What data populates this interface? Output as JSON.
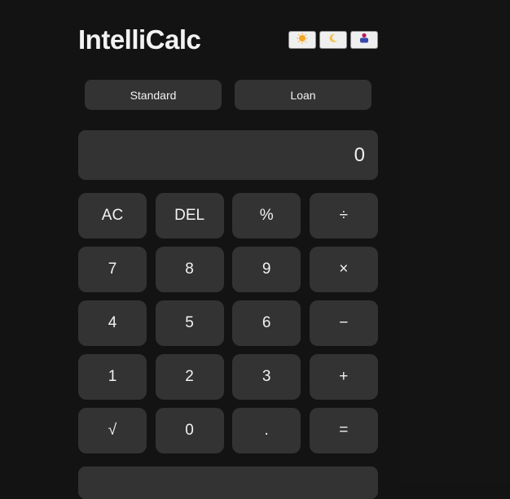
{
  "app": {
    "title": "IntelliCalc"
  },
  "themes": [
    {
      "name": "sun-icon"
    },
    {
      "name": "moon-icon"
    },
    {
      "name": "contrast-icon"
    }
  ],
  "tabs": [
    {
      "label": "Standard"
    },
    {
      "label": "Loan"
    }
  ],
  "display": {
    "value": "0"
  },
  "keys": [
    {
      "label": "AC",
      "name": "clear-all-button"
    },
    {
      "label": "DEL",
      "name": "delete-button"
    },
    {
      "label": "%",
      "name": "percent-button"
    },
    {
      "label": "÷",
      "name": "divide-button"
    },
    {
      "label": "7",
      "name": "digit-7-button"
    },
    {
      "label": "8",
      "name": "digit-8-button"
    },
    {
      "label": "9",
      "name": "digit-9-button"
    },
    {
      "label": "×",
      "name": "multiply-button"
    },
    {
      "label": "4",
      "name": "digit-4-button"
    },
    {
      "label": "5",
      "name": "digit-5-button"
    },
    {
      "label": "6",
      "name": "digit-6-button"
    },
    {
      "label": "−",
      "name": "subtract-button"
    },
    {
      "label": "1",
      "name": "digit-1-button"
    },
    {
      "label": "2",
      "name": "digit-2-button"
    },
    {
      "label": "3",
      "name": "digit-3-button"
    },
    {
      "label": "+",
      "name": "add-button"
    },
    {
      "label": "√",
      "name": "sqrt-button"
    },
    {
      "label": "0",
      "name": "digit-0-button"
    },
    {
      "label": ".",
      "name": "decimal-button"
    },
    {
      "label": "=",
      "name": "equals-button"
    }
  ],
  "colors": {
    "background": "#131313",
    "surface": "#333333",
    "text": "#f2f2f2",
    "sun": "#f5a623",
    "moon": "#f2c14e",
    "contrast_top": "#c2185b",
    "contrast_bottom": "#3949ab"
  }
}
